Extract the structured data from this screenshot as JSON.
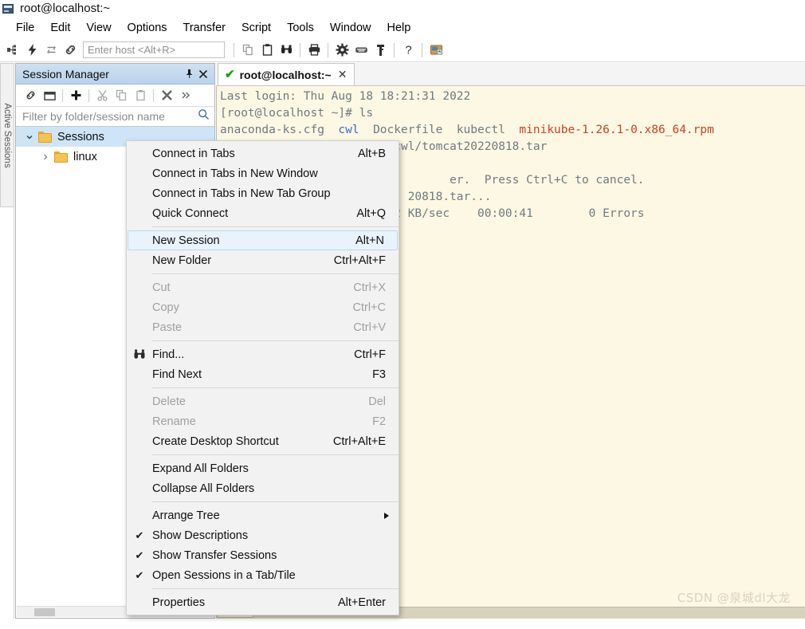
{
  "window": {
    "title": "root@localhost:~",
    "icon": "terminal-window-icon"
  },
  "menubar": {
    "items": [
      {
        "label": "File"
      },
      {
        "label": "Edit"
      },
      {
        "label": "View"
      },
      {
        "label": "Options"
      },
      {
        "label": "Transfer"
      },
      {
        "label": "Script"
      },
      {
        "label": "Tools"
      },
      {
        "label": "Window"
      },
      {
        "label": "Help"
      }
    ]
  },
  "toolbar": {
    "host_placeholder": "Enter host <Alt+R>",
    "buttons": [
      {
        "name": "connect-icon"
      },
      {
        "name": "quick-connect-icon"
      },
      {
        "name": "reconnect-icon"
      },
      {
        "name": "connect-sftp-icon"
      },
      {
        "name": "copy-icon"
      },
      {
        "name": "paste-icon"
      },
      {
        "name": "find-icon"
      },
      {
        "name": "print-icon"
      },
      {
        "name": "settings-icon"
      },
      {
        "name": "keyboard-icon"
      },
      {
        "name": "key-icon"
      },
      {
        "name": "help-icon"
      },
      {
        "name": "file-transfer-icon"
      }
    ]
  },
  "active_sessions_strip": {
    "label": "Active Sessions"
  },
  "session_manager": {
    "title": "Session Manager",
    "pin_glyph": " ",
    "close_glyph": "✕",
    "filter_placeholder": "Filter by folder/session name",
    "toolbar_buttons": [
      {
        "name": "connect-session-icon"
      },
      {
        "name": "new-folder-window-icon"
      },
      {
        "name": "new-session-icon"
      },
      {
        "name": "cut-icon"
      },
      {
        "name": "copy-icon"
      },
      {
        "name": "paste-icon"
      },
      {
        "name": "delete-icon"
      },
      {
        "name": "more-icon"
      }
    ],
    "tree": [
      {
        "label": "Sessions",
        "expanded": true,
        "selected": true,
        "twisty": "⌄"
      },
      {
        "label": "linux",
        "expanded": false,
        "selected": false,
        "twisty": "›"
      }
    ]
  },
  "terminal": {
    "tab": {
      "label": "root@localhost:~",
      "status_glyph": "✔",
      "close_glyph": "✕"
    },
    "lines": [
      {
        "segments": [
          {
            "text": "Last login: Thu Aug 18 18:21:31 2022",
            "style": "normal"
          }
        ]
      },
      {
        "segments": [
          {
            "text": "[root@localhost ~]# ls",
            "style": "normal"
          }
        ]
      },
      {
        "segments": [
          {
            "text": "anaconda-ks.cfg  ",
            "style": "normal"
          },
          {
            "text": "cwl",
            "style": "dir"
          },
          {
            "text": "  Dockerfile  kubectl  ",
            "style": "normal"
          },
          {
            "text": "minikube-1.26.1-0.x86_64.rpm",
            "style": "rpm"
          }
        ]
      },
      {
        "segments": [
          {
            "text": "[root@localhost ~]# sz ./cwl/tomcat20220818.tar",
            "style": "normal"
          }
        ]
      },
      {
        "segments": [
          {
            "text": "",
            "style": "normal"
          }
        ]
      },
      {
        "segments": [
          {
            "text": "                                 er.  Press Ctrl+C to cancel.",
            "style": "normal"
          }
        ]
      },
      {
        "segments": [
          {
            "text": "                           20818.tar...",
            "style": "normal"
          }
        ]
      },
      {
        "segments": [
          {
            "text": "                      6482 KB/sec    00:00:41        0 Errors",
            "style": "normal"
          }
        ]
      }
    ]
  },
  "context_menu": {
    "items": [
      {
        "type": "item",
        "label": "Connect in Tabs",
        "accel": "Alt+B",
        "disabled": false,
        "highlighted": false,
        "icon": ""
      },
      {
        "type": "item",
        "label": "Connect in Tabs in New Window",
        "accel": "",
        "disabled": false,
        "highlighted": false,
        "icon": ""
      },
      {
        "type": "item",
        "label": "Connect in Tabs in New Tab Group",
        "accel": "",
        "disabled": false,
        "highlighted": false,
        "icon": ""
      },
      {
        "type": "item",
        "label": "Quick Connect",
        "accel": "Alt+Q",
        "disabled": false,
        "highlighted": false,
        "icon": ""
      },
      {
        "type": "separator"
      },
      {
        "type": "item",
        "label": "New Session",
        "accel": "Alt+N",
        "disabled": false,
        "highlighted": true,
        "icon": ""
      },
      {
        "type": "item",
        "label": "New Folder",
        "accel": "Ctrl+Alt+F",
        "disabled": false,
        "highlighted": false,
        "icon": ""
      },
      {
        "type": "separator"
      },
      {
        "type": "item",
        "label": "Cut",
        "accel": "Ctrl+X",
        "disabled": true,
        "highlighted": false,
        "icon": ""
      },
      {
        "type": "item",
        "label": "Copy",
        "accel": "Ctrl+C",
        "disabled": true,
        "highlighted": false,
        "icon": ""
      },
      {
        "type": "item",
        "label": "Paste",
        "accel": "Ctrl+V",
        "disabled": true,
        "highlighted": false,
        "icon": ""
      },
      {
        "type": "separator"
      },
      {
        "type": "item",
        "label": "Find...",
        "accel": "Ctrl+F",
        "disabled": false,
        "highlighted": false,
        "icon": "binoculars-icon"
      },
      {
        "type": "item",
        "label": "Find Next",
        "accel": "F3",
        "disabled": false,
        "highlighted": false,
        "icon": ""
      },
      {
        "type": "separator"
      },
      {
        "type": "item",
        "label": "Delete",
        "accel": "Del",
        "disabled": true,
        "highlighted": false,
        "icon": ""
      },
      {
        "type": "item",
        "label": "Rename",
        "accel": "F2",
        "disabled": true,
        "highlighted": false,
        "icon": ""
      },
      {
        "type": "item",
        "label": "Create Desktop Shortcut",
        "accel": "Ctrl+Alt+E",
        "disabled": false,
        "highlighted": false,
        "icon": ""
      },
      {
        "type": "separator"
      },
      {
        "type": "item",
        "label": "Expand All Folders",
        "accel": "",
        "disabled": false,
        "highlighted": false,
        "icon": ""
      },
      {
        "type": "item",
        "label": "Collapse All Folders",
        "accel": "",
        "disabled": false,
        "highlighted": false,
        "icon": ""
      },
      {
        "type": "separator"
      },
      {
        "type": "item",
        "label": "Arrange Tree",
        "accel": "",
        "disabled": false,
        "highlighted": false,
        "icon": "",
        "submenu": true
      },
      {
        "type": "item",
        "label": "Show Descriptions",
        "accel": "",
        "disabled": false,
        "highlighted": false,
        "icon": "check-icon"
      },
      {
        "type": "item",
        "label": "Show Transfer Sessions",
        "accel": "",
        "disabled": false,
        "highlighted": false,
        "icon": "check-icon"
      },
      {
        "type": "item",
        "label": "Open Sessions in a Tab/Tile",
        "accel": "",
        "disabled": false,
        "highlighted": false,
        "icon": "check-icon"
      },
      {
        "type": "separator"
      },
      {
        "type": "item",
        "label": "Properties",
        "accel": "Alt+Enter",
        "disabled": false,
        "highlighted": false,
        "icon": ""
      }
    ]
  },
  "watermark": {
    "text": "CSDN @泉城dl大龙"
  },
  "colors": {
    "terminal_bg": "#fdf8e3",
    "terminal_fg": "#6f7a84",
    "terminal_dir": "#2f6fd0",
    "terminal_rpm": "#cf4020",
    "panel_header": "#bdd6ee",
    "selection": "#cfe4f7",
    "menu_bg": "#f2f2f2",
    "menu_highlight": "#e8f3fd"
  }
}
